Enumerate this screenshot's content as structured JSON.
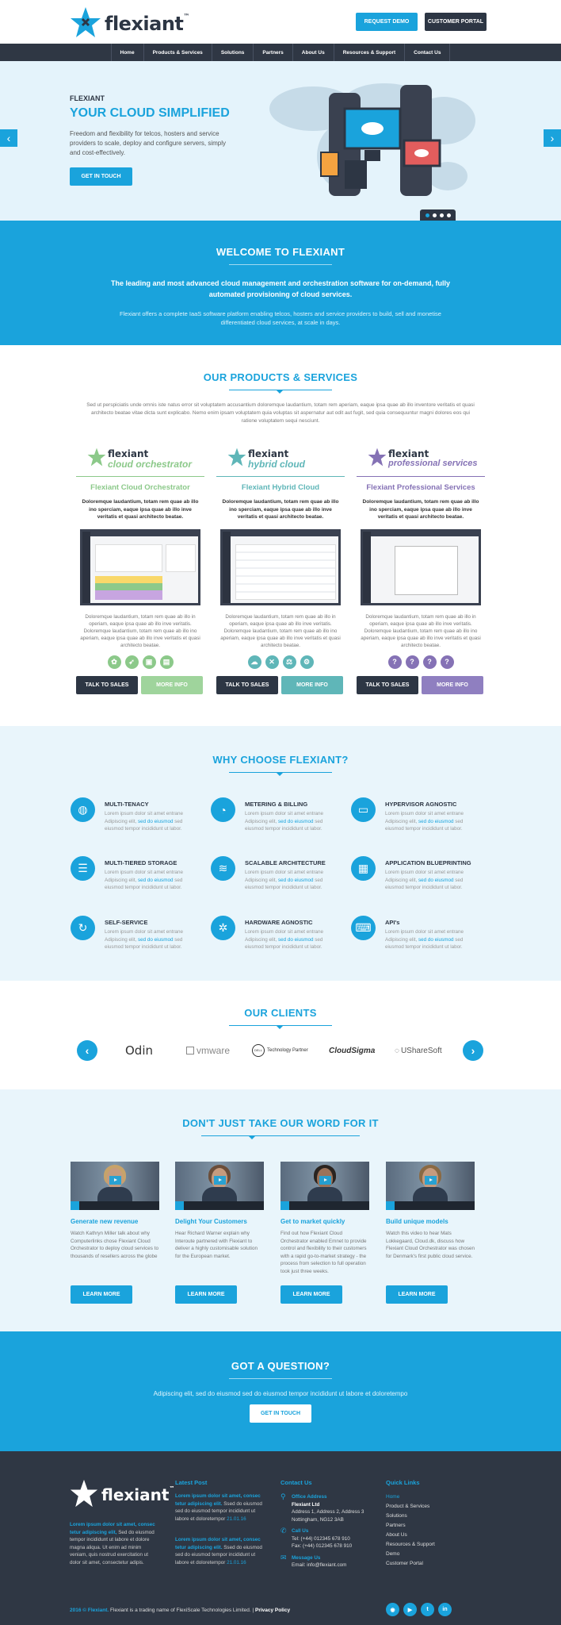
{
  "brand": {
    "name": "flexiant",
    "tm": "™",
    "accent": "#1aa3dc",
    "dark": "#2f3744"
  },
  "header": {
    "request_demo": "REQUEST DEMO",
    "customer_portal": "CUSTOMER PORTAL"
  },
  "nav": [
    "Home",
    "Products & Services",
    "Solutions",
    "Partners",
    "About Us",
    "Resources & Support",
    "Contact Us"
  ],
  "hero": {
    "eyebrow": "FLEXIANT",
    "title": "YOUR CLOUD SIMPLIFIED",
    "desc": "Freedom and flexibility for telcos, hosters and service providers to scale, deploy and configure servers, simply and cost-effectively.",
    "cta": "GET IN TOUCH",
    "prev_icon": "chevron-left-icon",
    "next_icon": "chevron-right-icon",
    "slides": 4,
    "active_slide": 1
  },
  "welcome": {
    "title": "WELCOME TO FLEXIANT",
    "lead": "The leading and most advanced cloud management and orchestration software for on-demand, fully automated provisioning of cloud services.",
    "sub": "Flexiant offers a complete IaaS software platform enabling telcos, hosters and service providers to build, sell and monetise differentiated cloud services, at scale in days."
  },
  "products": {
    "title": "OUR PRODUCTS & SERVICES",
    "intro": "Sed ut perspiciatis unde omnis iste natus error sit voluptatem accusantium doloremque laudantium, totam rem aperiam, eaque ipsa quae ab illo inventore veritatis et quasi architecto beatae vitae dicta sunt explicabo. Nemo enim ipsam voluptatem quia voluptas sit aspernatur aut odit aut fugit, sed quia consequuntur magni dolores eos qui ratione voluptatem sequi nesciunt.",
    "items": [
      {
        "logo_sub": "cloud orchestrator",
        "title": "Flexiant Cloud Orchestrator",
        "color": "#8cc98a",
        "bold": "Doloremque laudantium, totam rem quae ab illo ino sperciam, eaque ipsa quae ab illo inve veritatis et quasi architecto beatae.",
        "text": "Doloremque laudantium, totam rem quae ab illo in operiam, eaque ipsa quae ab illo inve veritatis. Doloremque laudantium, totam rem quae ab illo ino aperiam, eaque ipsa quae ab illo inve veritatis et quasi architecto beatae.",
        "talk": "TALK TO SALES",
        "more": "MORE INFO",
        "icons": [
          "leaf-icon",
          "rocket-icon",
          "box-icon",
          "chart-icon"
        ]
      },
      {
        "logo_sub": "hybrid cloud",
        "title": "Flexiant Hybrid Cloud",
        "color": "#5fb6b8",
        "bold": "Doloremque laudantium, totam rem quae ab illo ino sperciam, eaque ipsa quae ab illo inve veritatis et quasi architecto beatae.",
        "text": "Doloremque laudantium, totam rem quae ab illo in operiam, eaque ipsa quae ab illo inve veritatis. Doloremque laudantium, totam rem quae ab illo ino aperiam, eaque ipsa quae ab illo inve veritatis et quasi architecto beatae.",
        "talk": "TALK TO SALES",
        "more": "MORE INFO",
        "icons": [
          "cloud-icon",
          "cross-icon",
          "balance-icon",
          "gear-icon"
        ]
      },
      {
        "logo_sub": "professional services",
        "title": "Flexiant Professional Services",
        "color": "#8572b5",
        "bold": "Doloremque laudantium, totam rem quae ab illo ino sperciam, eaque ipsa quae ab illo inve veritatis et quasi architecto beatae.",
        "text": "Doloremque laudantium, totam rem quae ab illo in operiam, eaque ipsa quae ab illo inve veritatis. Doloremque laudantium, totam rem quae ab illo ino aperiam, eaque ipsa quae ab illo inve veritatis et quasi architecto beatae.",
        "talk": "TALK TO SALES",
        "more": "MORE INFO",
        "icons": [
          "question-icon",
          "question-icon",
          "question-icon",
          "question-icon"
        ]
      }
    ]
  },
  "why": {
    "title": "WHY CHOOSE FLEXIANT?",
    "features": [
      {
        "title": "MULTI-TENACY",
        "icon": "globe-icon"
      },
      {
        "title": "METERING & BILLING",
        "icon": "meter-icon"
      },
      {
        "title": "HYPERVISOR AGNOSTIC",
        "icon": "monitor-icon"
      },
      {
        "title": "MULTI-TIERED STORAGE",
        "icon": "database-icon"
      },
      {
        "title": "SCALABLE ARCHITECTURE",
        "icon": "layers-icon"
      },
      {
        "title": "APPLICATION BLUEPRINTING",
        "icon": "blueprint-icon"
      },
      {
        "title": "SELF-SERVICE",
        "icon": "refresh-icon"
      },
      {
        "title": "HARDWARE AGNOSTIC",
        "icon": "network-icon"
      },
      {
        "title": "API's",
        "icon": "code-icon"
      }
    ],
    "desc_pre": "Lorem ipsum dolor sit amet entrane Adipiscing elit, ",
    "desc_hl": "sed do eiusmod",
    "desc_post": " sed eiusmod tempor incididunt ut labor."
  },
  "clients": {
    "title": "OUR CLIENTS",
    "logos": [
      "Odin",
      "vmware",
      "Technology Partner",
      "CloudSigma",
      "UShareSoft"
    ]
  },
  "testimonials": {
    "title": "DON'T JUST TAKE OUR WORD FOR IT",
    "items": [
      {
        "title": "Generate new revenue",
        "desc_hl": "",
        "desc": "Watch Kathryn Miller talk about why Computerlinks chose Flexiant Cloud Orchestrator to deploy cloud services to thousands of resellers across the globe",
        "btn": "LEARN MORE"
      },
      {
        "title": "Delight Your Customers",
        "desc": "Hear Richard Warner explain why Interoute partnered with Flexiant to deliver a highly customisable solution for the European market.",
        "btn": "LEARN MORE"
      },
      {
        "title": "Get to market quickly",
        "desc": "Find out how Flexiant Cloud Orchestrator enabled Emnet to provide control and flexibility to their customers with a rapid go-to-market strategy - the process from selection to full operation took just three weeks.",
        "btn": "LEARN MORE"
      },
      {
        "title": "Build unique models",
        "desc": "Watch this video to hear Mats Lokkegaard, Cloud.dk, discuss how Flexiant Cloud Orchestrator was chosen for Denmark's first public cloud service.",
        "btn": "LEARN MORE"
      }
    ]
  },
  "question": {
    "title": "GOT A QUESTION?",
    "sub": "Adipiscing elit, sed do eiusmod sed do eiusmod tempor incididunt ut labore et doloretempo",
    "btn": "GET IN TOUCH"
  },
  "footer": {
    "about_hl": "Lorem ipsum dolor sit amet, consec tetur adipiscing elit,",
    "about": "Sed do eiusmod tempor incididunt ut labore et dolore magna aliqua. Ut enim ad minim veniam, quis nostrud exercitation ut dolor sit amet, consectetur adipis.",
    "latest_title": "Latest Post",
    "posts": [
      {
        "hl": "Lorem ipsum dolor sit amet, consec tetur adipiscing elit.",
        "text": " Ssed do eiusmod sed do eiusmod tempor incididunt ut labore et doloretempor ",
        "date": "21.01.16"
      },
      {
        "hl": "Lorem ipsum dolor sit amet, consec tetur adipiscing elit.",
        "text": " Ssed do eiusmod sed do eiusmod tempor incididunt ut labore et doloretempor ",
        "date": "21.01.16"
      }
    ],
    "contact_title": "Contact Us",
    "address_label": "Office Address",
    "address_name": "Flexiant Ltd",
    "address_line1": "Address 1, Address 2, Address 3",
    "address_line2": "Nottingham, NG12 3AB",
    "call_label": "Call Us",
    "tel": "Tel: (+44) 012345 678 910",
    "fax": "Fax: (+44) 012345 678 910",
    "msg_label": "Message Us",
    "email": "Email: info@flexiant.com",
    "links_title": "Quick Links",
    "links": [
      "Home",
      "Product & Services",
      "Solutions",
      "Partners",
      "About Us",
      "Resources & Support",
      "Demo",
      "Customer Portal"
    ],
    "copyright_hl": "2016 © Flexiant.",
    "copyright": " Flexiant is a trading name of FlexiScale Technologies Limited. | ",
    "privacy": "Privacy Policy",
    "social": [
      "rss-icon",
      "youtube-icon",
      "twitter-icon",
      "linkedin-icon"
    ]
  }
}
